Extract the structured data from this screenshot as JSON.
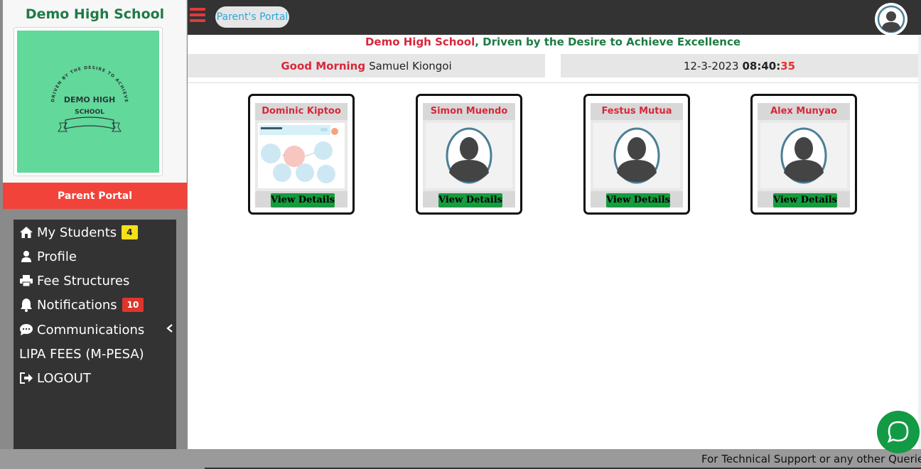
{
  "sidebar": {
    "school_name": "Demo High School",
    "logo": {
      "line1": "DEMO HIGH",
      "line2": "SCHOOL",
      "arc_text": "DRIVEN BY THE DESIRE TO ACHIEVE EXCELLENCE"
    },
    "portal_label": "Parent Portal",
    "menu": [
      {
        "label": "My Students",
        "icon": "home-icon",
        "badge": "4"
      },
      {
        "label": "Profile",
        "icon": "user-icon"
      },
      {
        "label": "Fee Structures",
        "icon": "print-icon"
      },
      {
        "label": "Notifications",
        "icon": "bell-icon",
        "badge": "10"
      },
      {
        "label": "Communications",
        "icon": "chat-bubble-icon"
      },
      {
        "label": "LIPA FEES (M-PESA)"
      },
      {
        "label": "LOGOUT",
        "icon": "sign-out-icon"
      }
    ]
  },
  "topbar": {
    "portal_pill": "Parent's Portal"
  },
  "motto": {
    "school": "Demo High School",
    "rest": ", Driven by the Desire to Achieve Excellence"
  },
  "greeting": {
    "salutation": "Good Morning",
    "name": "Samuel Kiongoi"
  },
  "clock": {
    "date": "12-3-2023",
    "hm": "08:40:",
    "seconds": "35"
  },
  "students": [
    {
      "name": "Dominic Kiptoo",
      "button": "View Details",
      "photo": "diagram"
    },
    {
      "name": "Simon Muendo",
      "button": "View Details",
      "photo": "placeholder"
    },
    {
      "name": "Festus Mutua",
      "button": "View Details",
      "photo": "placeholder"
    },
    {
      "name": "Alex Munyao",
      "button": "View Details",
      "photo": "placeholder"
    }
  ],
  "footer": {
    "text": "For Technical Support or any other Queries Ca"
  },
  "colors": {
    "brand_green": "#1e7b45",
    "accent_red": "#f2433b",
    "button_green": "#179b3f",
    "chat_green": "#129a45"
  }
}
